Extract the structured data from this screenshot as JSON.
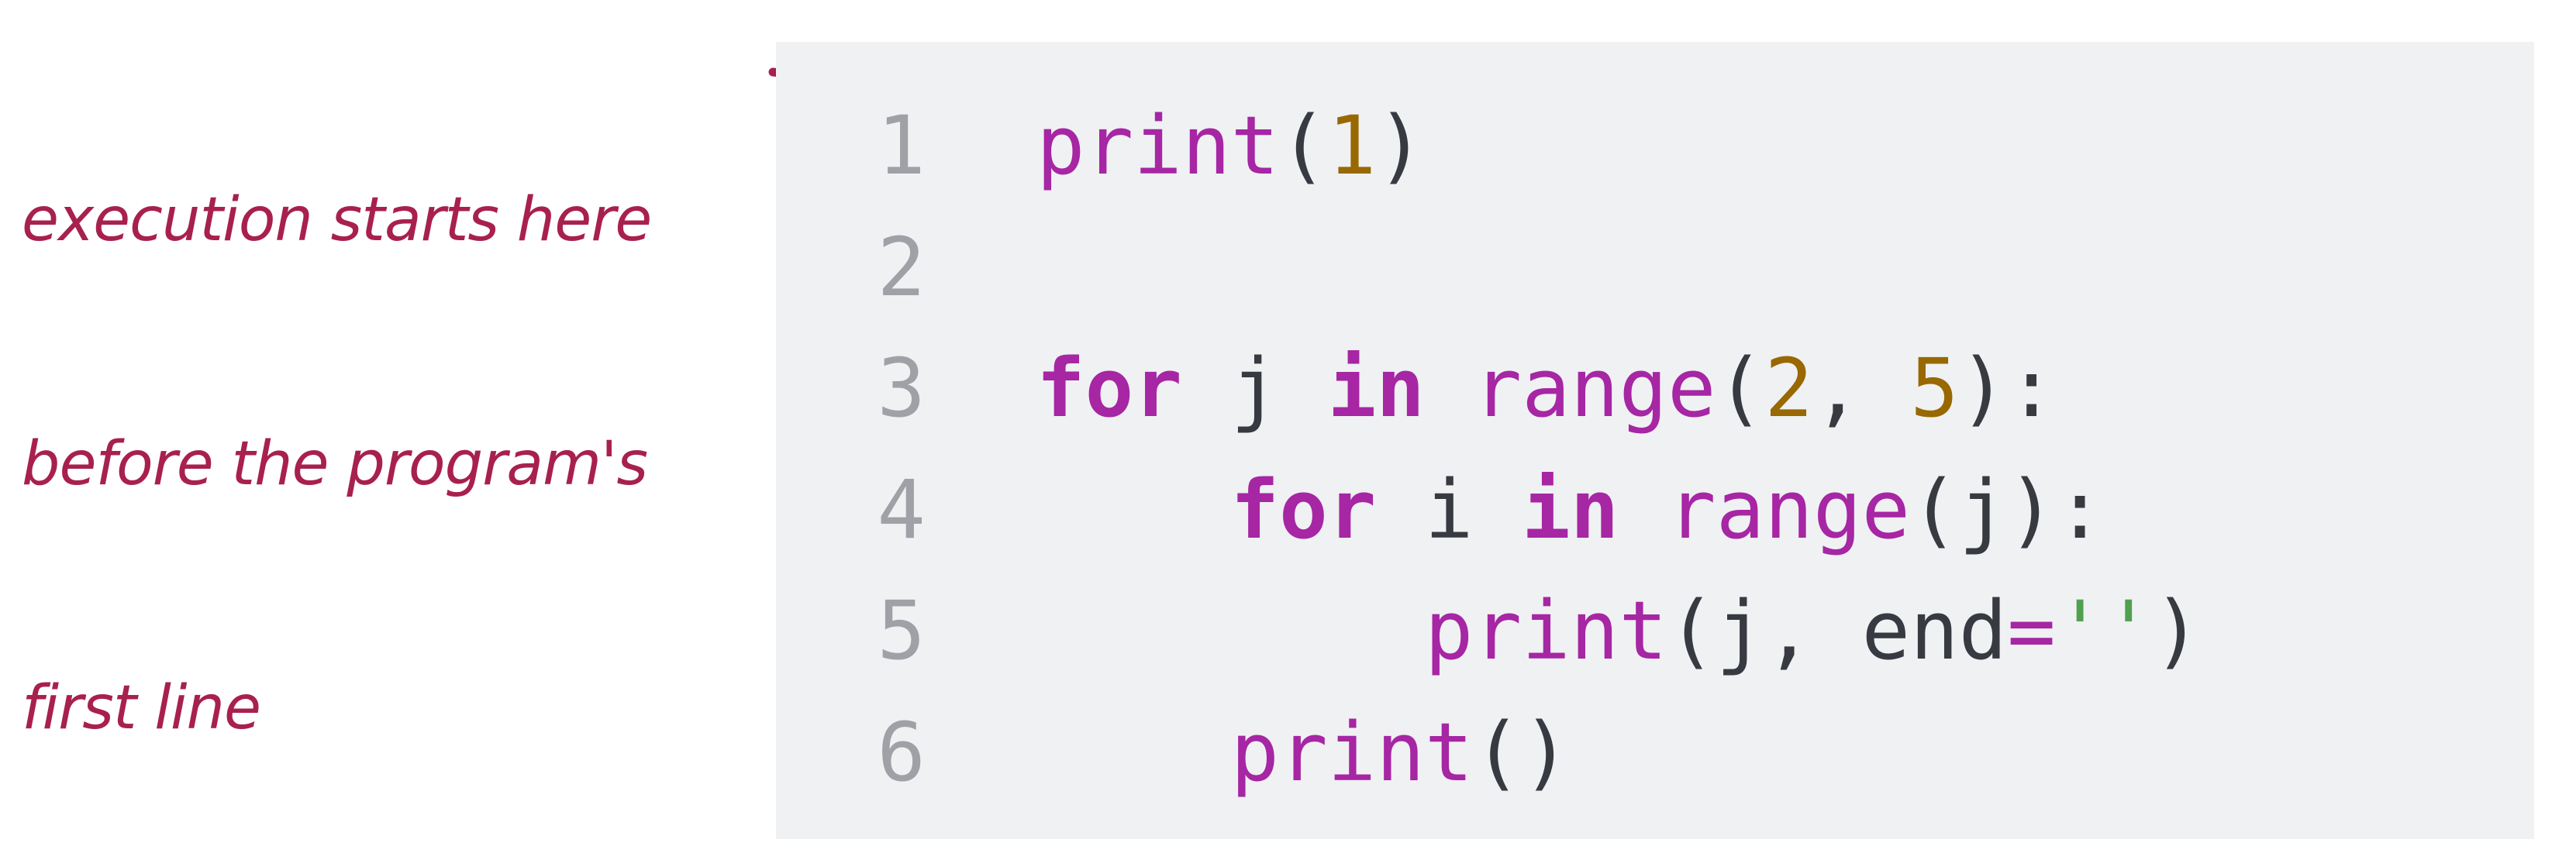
{
  "annotation": {
    "lines": [
      "execution starts here",
      "before the program's",
      "first line"
    ],
    "color": "#a8204e"
  },
  "arrow_icon": "arrow-right-icon",
  "code": {
    "language": "python",
    "colors": {
      "background": "#f0f1f3",
      "line_number": "#a0a1a7",
      "keyword": "#a626a4",
      "function": "#a626a4",
      "number": "#986801",
      "string": "#50a14f",
      "plain": "#383a42"
    },
    "lines": [
      {
        "number": "1",
        "tokens": [
          {
            "t": "print",
            "k": "fn"
          },
          {
            "t": "(",
            "k": "plain"
          },
          {
            "t": "1",
            "k": "num"
          },
          {
            "t": ")",
            "k": "plain"
          }
        ]
      },
      {
        "number": "2",
        "tokens": []
      },
      {
        "number": "3",
        "tokens": [
          {
            "t": "for",
            "k": "kw"
          },
          {
            "t": " j ",
            "k": "plain"
          },
          {
            "t": "in",
            "k": "kw"
          },
          {
            "t": " ",
            "k": "plain"
          },
          {
            "t": "range",
            "k": "fn"
          },
          {
            "t": "(",
            "k": "plain"
          },
          {
            "t": "2",
            "k": "num"
          },
          {
            "t": ", ",
            "k": "plain"
          },
          {
            "t": "5",
            "k": "num"
          },
          {
            "t": "):",
            "k": "plain"
          }
        ]
      },
      {
        "number": "4",
        "tokens": [
          {
            "t": "    ",
            "k": "plain"
          },
          {
            "t": "for",
            "k": "kw"
          },
          {
            "t": " i ",
            "k": "plain"
          },
          {
            "t": "in",
            "k": "kw"
          },
          {
            "t": " ",
            "k": "plain"
          },
          {
            "t": "range",
            "k": "fn"
          },
          {
            "t": "(j):",
            "k": "plain"
          }
        ]
      },
      {
        "number": "5",
        "tokens": [
          {
            "t": "        ",
            "k": "plain"
          },
          {
            "t": "print",
            "k": "fn"
          },
          {
            "t": "(j, end",
            "k": "plain"
          },
          {
            "t": "=",
            "k": "op"
          },
          {
            "t": "''",
            "k": "str"
          },
          {
            "t": ")",
            "k": "plain"
          }
        ]
      },
      {
        "number": "6",
        "tokens": [
          {
            "t": "    ",
            "k": "plain"
          },
          {
            "t": "print",
            "k": "fn"
          },
          {
            "t": "()",
            "k": "plain"
          }
        ]
      }
    ]
  }
}
